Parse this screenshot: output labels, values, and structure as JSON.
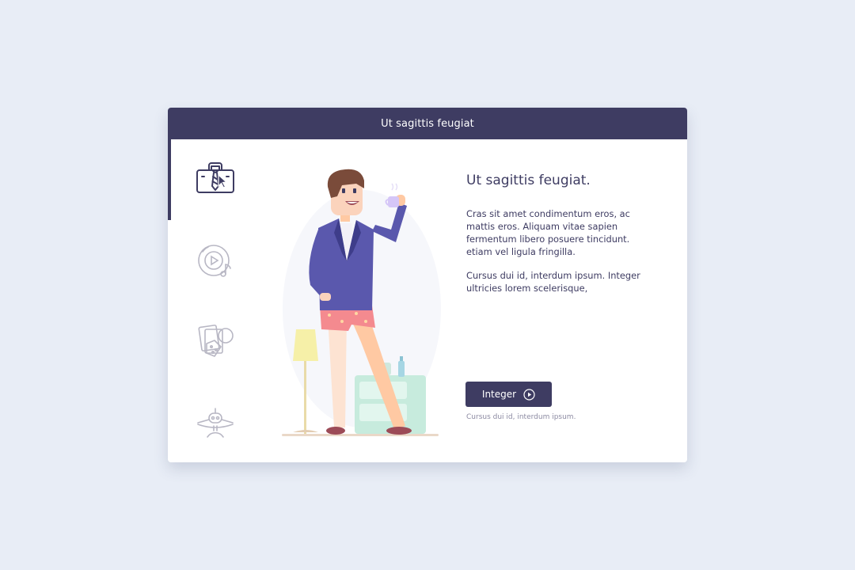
{
  "header": {
    "title": "Ut sagittis feugiat"
  },
  "sidebar": {
    "items": [
      {
        "icon": "briefcase-tie-icon",
        "active": true
      },
      {
        "icon": "music-disc-icon",
        "active": false
      },
      {
        "icon": "cards-dice-icon",
        "active": false
      },
      {
        "icon": "plane-globe-icon",
        "active": false
      }
    ]
  },
  "main": {
    "heading": "Ut sagittis feugiat.",
    "paragraph1": "Cras sit amet condimentum eros, ac mattis eros. Aliquam vitae sapien fermentum libero posuere tincidunt. etiam vel ligula fringilla.",
    "paragraph2": "Cursus dui id, interdum ipsum. Integer ultricies lorem scelerisque,",
    "button_label": "Integer",
    "button_icon": "play-circle-icon",
    "note": "Cursus dui id, interdum ipsum."
  },
  "colors": {
    "background": "#e8edf6",
    "header": "#3e3c62",
    "accent": "#3e3c62",
    "muted_text": "#8c8aa2"
  }
}
